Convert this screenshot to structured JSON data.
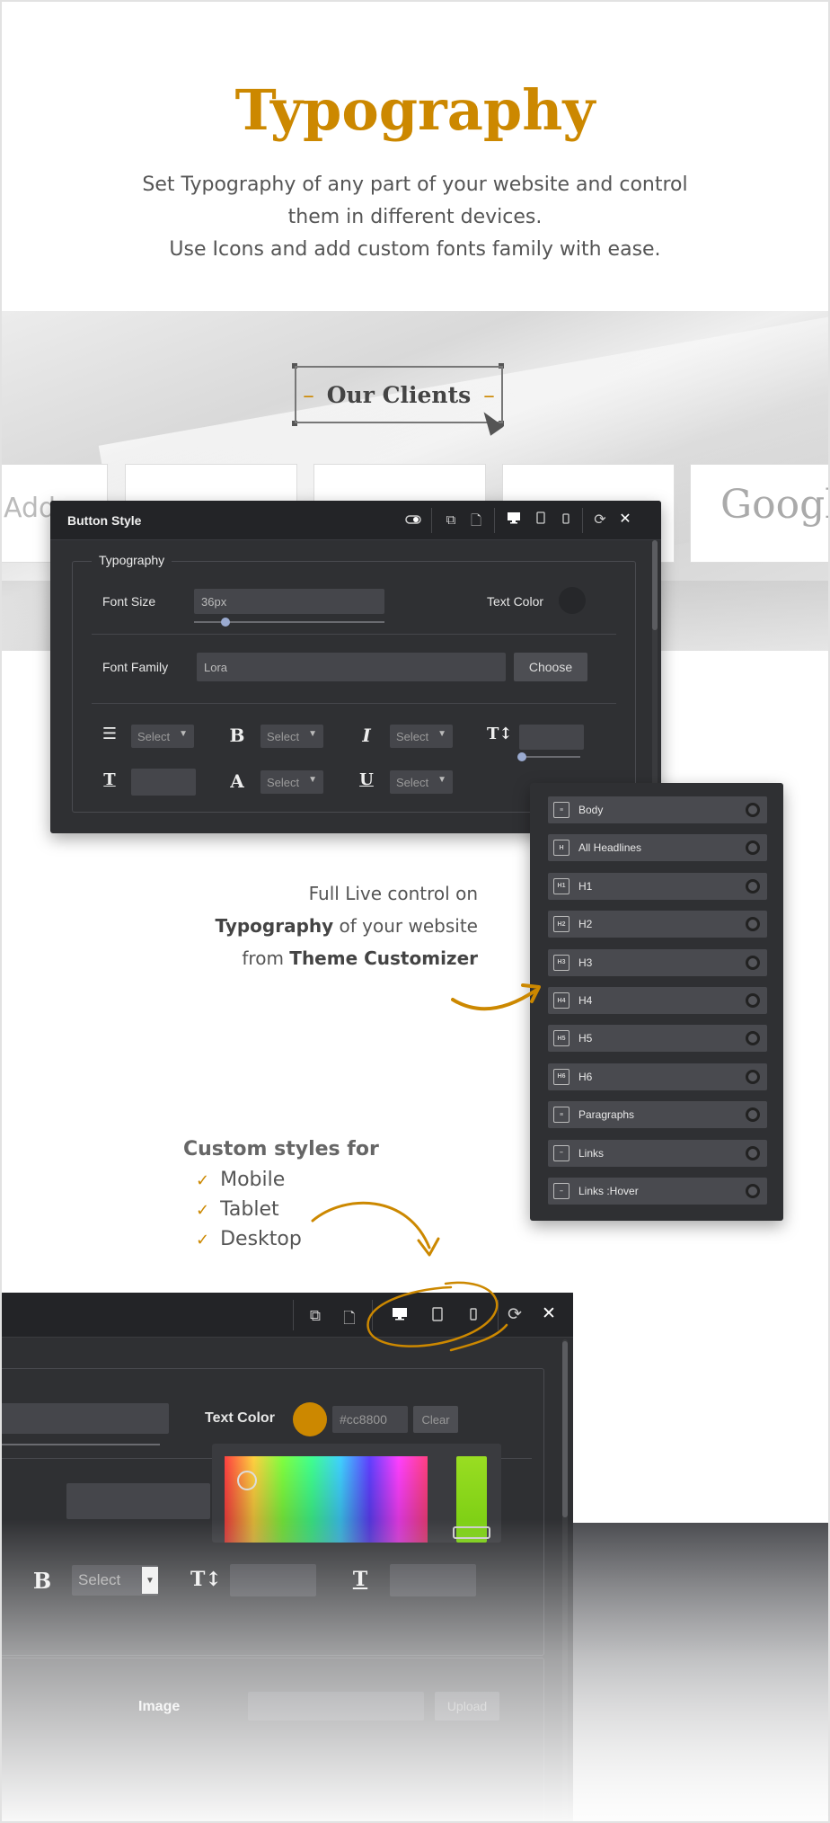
{
  "hero": {
    "title": "Typography",
    "desc_line1": "Set Typography of any part of your website and control",
    "desc_line2": "them in different devices.",
    "desc_line3": "Use Icons and add custom fonts family with ease."
  },
  "clients": {
    "label": "Our Clients",
    "dash": "–",
    "logo_left": "Add",
    "logo_right": "Google"
  },
  "button_style": {
    "title": "Button Style",
    "fieldset": "Typography",
    "font_size_label": "Font Size",
    "font_size_value": "36px",
    "text_color_label": "Text Color",
    "font_family_label": "Font Family",
    "font_family_value": "Lora",
    "choose_label": "Choose",
    "select_label": "Select",
    "close": "✕"
  },
  "headline_list": {
    "items": [
      {
        "label": "Body",
        "icon": "≡"
      },
      {
        "label": "All Headlines",
        "icon": "H"
      },
      {
        "label": "H1",
        "icon": "H1"
      },
      {
        "label": "H2",
        "icon": "H2"
      },
      {
        "label": "H3",
        "icon": "H3"
      },
      {
        "label": "H4",
        "icon": "H4"
      },
      {
        "label": "H5",
        "icon": "H5"
      },
      {
        "label": "H6",
        "icon": "H6"
      },
      {
        "label": "Paragraphs",
        "icon": "≡"
      },
      {
        "label": "Links",
        "icon": "–"
      },
      {
        "label": "Links :Hover",
        "icon": "–"
      }
    ]
  },
  "live": {
    "line1": "Full Live control on",
    "line2_bold": "Typography",
    "line2_rest": " of your website",
    "line3_pre": "from ",
    "line3_bold": "Theme Customizer"
  },
  "custom": {
    "title": "Custom styles for",
    "items": [
      "Mobile",
      "Tablet",
      "Desktop"
    ],
    "check": "✓"
  },
  "big_panel": {
    "text_color_label": "Text Color",
    "hex_value": "#cc8800",
    "clear_label": "Clear",
    "select_label": "Select",
    "image_label": "Image",
    "upload_label": "Upload",
    "close": "✕"
  },
  "colors": {
    "accent": "#cc8800",
    "panel_bg": "#2f3033",
    "panel_header": "#232427"
  }
}
